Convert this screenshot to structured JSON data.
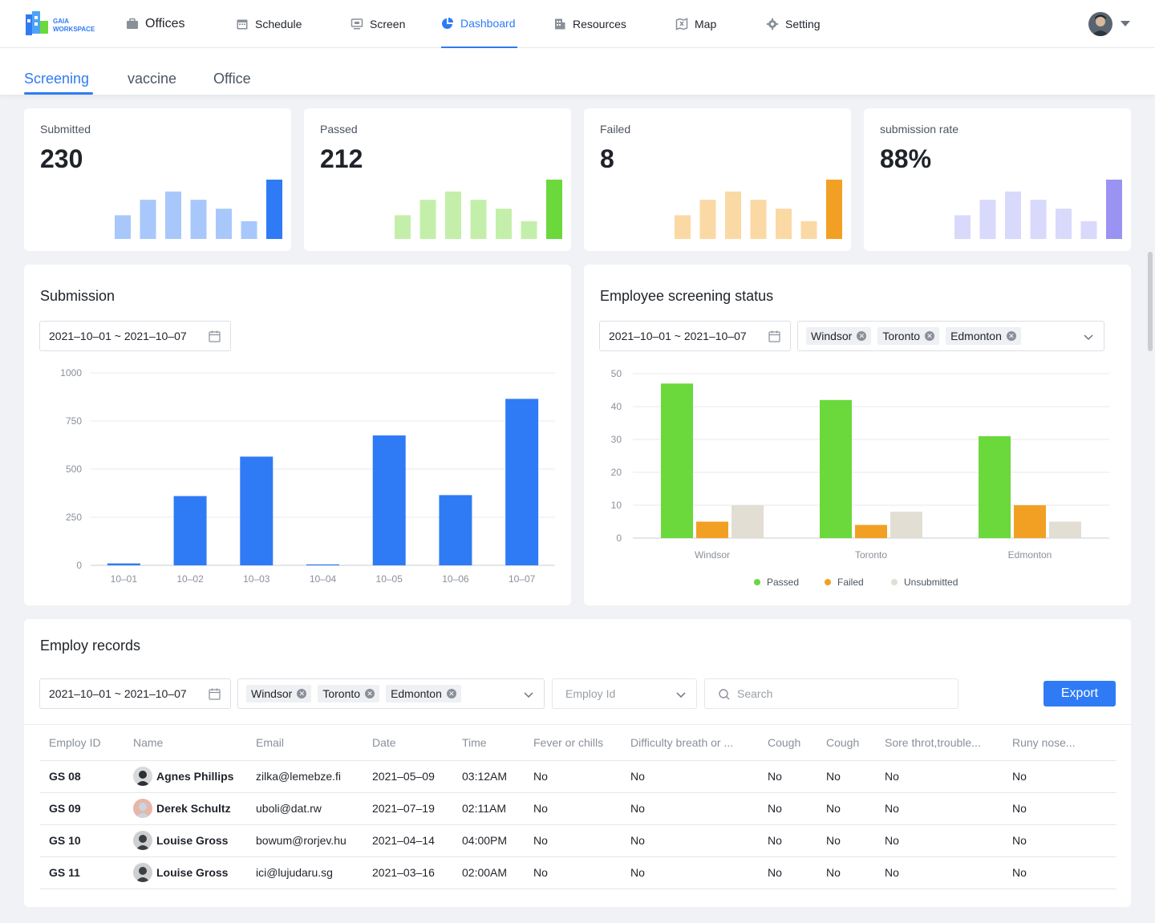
{
  "app": {
    "logo_text_1": "GAIA",
    "logo_text_2": "WORKSPACE"
  },
  "nav": {
    "items": [
      {
        "label": "Offices",
        "icon": "briefcase-icon"
      },
      {
        "label": "Schedule",
        "icon": "calendar-icon"
      },
      {
        "label": "Screen",
        "icon": "monitor-icon"
      },
      {
        "label": "Dashboard",
        "icon": "pie-chart-icon",
        "active": true
      },
      {
        "label": "Resources",
        "icon": "building-icon"
      },
      {
        "label": "Map",
        "icon": "map-icon"
      },
      {
        "label": "Setting",
        "icon": "gear-icon"
      }
    ]
  },
  "tabs": [
    {
      "label": "Screening",
      "active": true
    },
    {
      "label": "vaccine"
    },
    {
      "label": "Office"
    }
  ],
  "stats": [
    {
      "label": "Submitted",
      "value": "230",
      "color_light": "#a8c8fb",
      "color_dark": "#2f7bf5",
      "bars": [
        0.4,
        0.66,
        0.8,
        0.66,
        0.51,
        0.3,
        1.0
      ]
    },
    {
      "label": "Passed",
      "value": "212",
      "color_light": "#c4efaa",
      "color_dark": "#6bd83c",
      "bars": [
        0.4,
        0.66,
        0.8,
        0.66,
        0.51,
        0.3,
        1.0
      ]
    },
    {
      "label": "Failed",
      "value": "8",
      "color_light": "#fbd9a4",
      "color_dark": "#f2a024",
      "bars": [
        0.4,
        0.66,
        0.8,
        0.66,
        0.51,
        0.3,
        1.0
      ]
    },
    {
      "label": "submission rate",
      "value": "88%",
      "color_light": "#d8d9fb",
      "color_dark": "#9a93f2",
      "bars": [
        0.4,
        0.66,
        0.8,
        0.66,
        0.51,
        0.3,
        1.0
      ]
    }
  ],
  "submission": {
    "title": "Submission",
    "date_range": "2021–10–01 ~ 2021–10–07"
  },
  "screening_status": {
    "title": "Employee screening status",
    "date_range": "2021–10–01 ~ 2021–10–07",
    "tags": [
      "Windsor",
      "Toronto",
      "Edmonton"
    ]
  },
  "chart_data": [
    {
      "type": "bar",
      "title": "Submission",
      "categories": [
        "10–01",
        "10–02",
        "10–03",
        "10–04",
        "10–05",
        "10–06",
        "10–07"
      ],
      "values": [
        10,
        360,
        565,
        5,
        675,
        365,
        865
      ],
      "ylim": [
        0,
        1000
      ],
      "yticks": [
        0,
        250,
        500,
        750,
        1000
      ],
      "color": "#2f7bf5",
      "grid": true
    },
    {
      "type": "bar",
      "categories": [
        "Windsor",
        "Toronto",
        "Edmonton"
      ],
      "series": [
        {
          "name": "Passed",
          "values": [
            47,
            42,
            31
          ],
          "color": "#6bd83c"
        },
        {
          "name": "Failed",
          "values": [
            5,
            4,
            10
          ],
          "color": "#f2a024"
        },
        {
          "name": "Unsubmitted",
          "values": [
            10,
            8,
            5
          ],
          "color": "#e2ded4"
        }
      ],
      "ylim": [
        0,
        50
      ],
      "yticks": [
        0,
        10,
        20,
        30,
        40,
        50
      ],
      "legend": "bottom-center",
      "grid": true
    }
  ],
  "records": {
    "title": "Employ records",
    "date_range": "2021–10–01 ~ 2021–10–07",
    "tags": [
      "Windsor",
      "Toronto",
      "Edmonton"
    ],
    "employ_id_placeholder": "Employ Id",
    "search_placeholder": "Search",
    "export_label": "Export",
    "columns": [
      "Employ ID",
      "Name",
      "Email",
      "Date",
      "Time",
      "Fever or chills",
      "Difficulty breath or ...",
      "Cough",
      "Cough",
      "Sore throt,trouble...",
      "Runy nose..."
    ],
    "rows": [
      [
        "GS 08",
        "Agnes Phillips",
        "zilka@lemebze.fi",
        "2021–05–09",
        "03:12AM",
        "No",
        "No",
        "No",
        "No",
        "No",
        "No"
      ],
      [
        "GS 09",
        "Derek Schultz",
        "uboli@dat.rw",
        "2021–07–19",
        "02:11AM",
        "No",
        "No",
        "No",
        "No",
        "No",
        "No"
      ],
      [
        "GS 10",
        "Louise Gross",
        "bowum@rorjev.hu",
        "2021–04–14",
        "04:00PM",
        "No",
        "No",
        "No",
        "No",
        "No",
        "No"
      ],
      [
        "GS 11",
        "Louise Gross",
        "ici@lujudaru.sg",
        "2021–03–16",
        "02:00AM",
        "No",
        "No",
        "No",
        "No",
        "No",
        "No"
      ]
    ]
  }
}
